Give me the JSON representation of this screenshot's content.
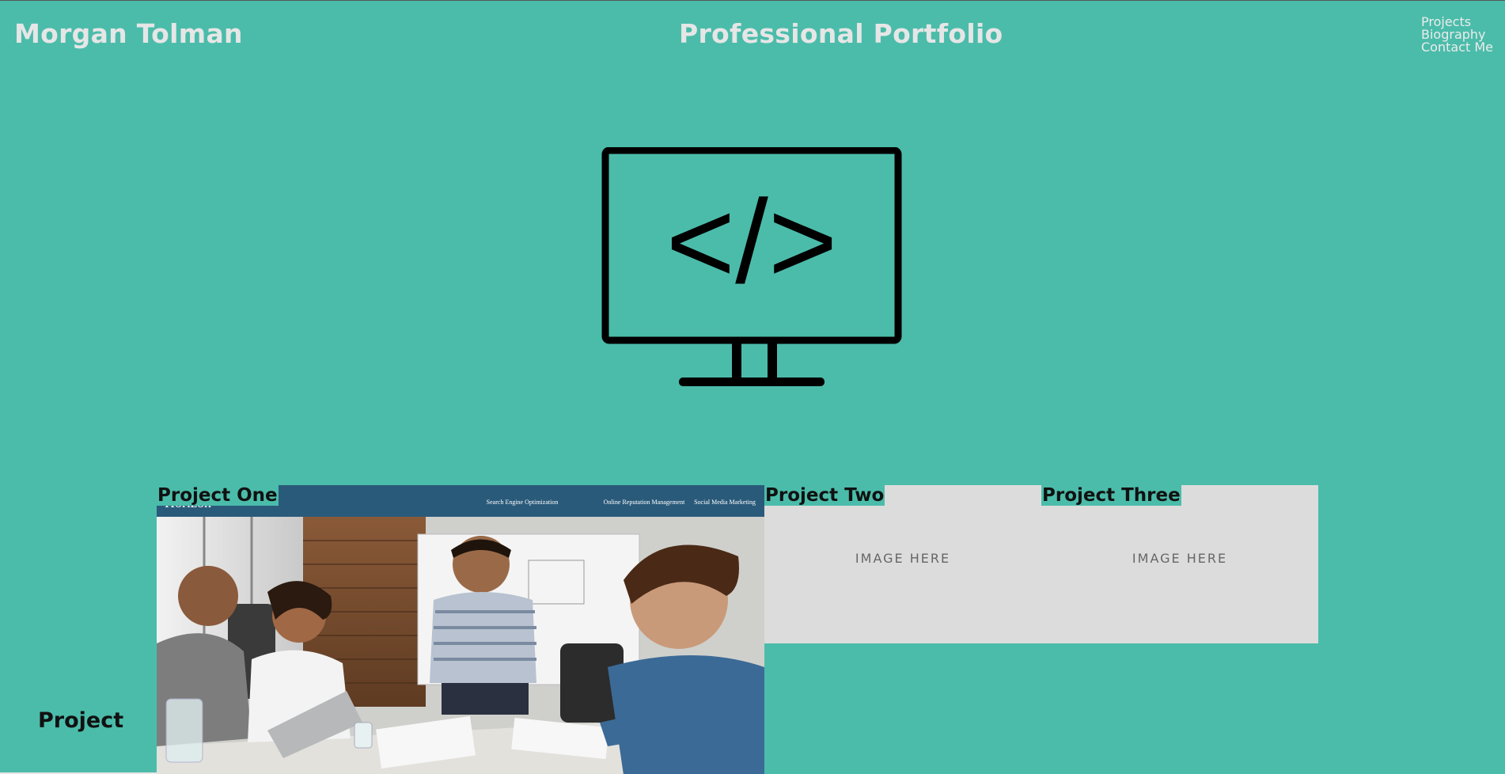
{
  "header": {
    "site_name": "Morgan Tolman",
    "title": "Professional Portfolio",
    "nav": [
      "Projects",
      "Biography",
      "Contact Me"
    ]
  },
  "hero": {
    "icon": "code-monitor-icon",
    "glyph": "</>"
  },
  "projects": [
    {
      "label": "Project One",
      "screenshot": {
        "brand": "Horizon",
        "nav": [
          "Search Engine Optimization",
          "Online Reputation Management",
          "Social Media Marketing"
        ]
      }
    },
    {
      "label": "Project Two",
      "placeholder": "IMAGE HERE"
    },
    {
      "label": "Project Three",
      "placeholder": "IMAGE HERE"
    }
  ],
  "footer": {
    "project_heading": "Project"
  },
  "colors": {
    "background": "#4bbcaa",
    "header_text": "#e6e6e6",
    "placeholder_bg": "#dcdcdc",
    "screenshot_bar": "#2a5a7a"
  }
}
